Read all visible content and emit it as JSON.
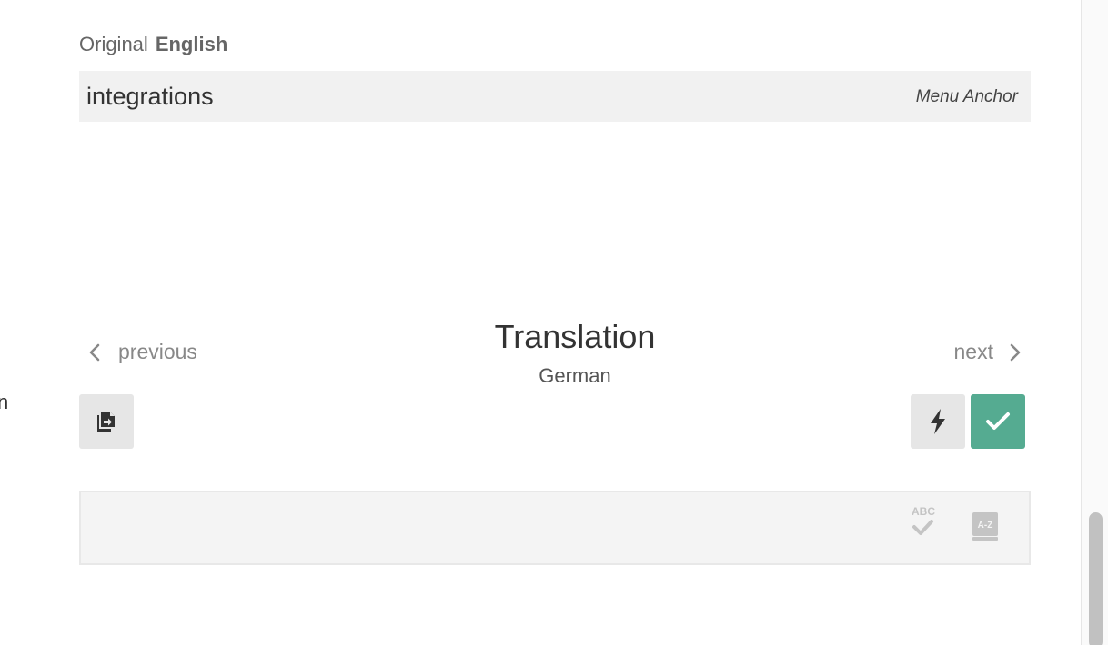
{
  "original": {
    "label": "Original",
    "language": "English",
    "text": "integrations",
    "context": "Menu Anchor"
  },
  "translation": {
    "title": "Translation",
    "language": "German",
    "text": ""
  },
  "navigation": {
    "previous_label": "previous",
    "next_label": "next"
  },
  "left_edge_fragment": "n",
  "icons": {
    "copy_original": "copy-original-icon",
    "machine_translate": "lightning-icon",
    "approve": "checkmark-icon",
    "spellcheck": "spellcheck-icon",
    "dictionary": "dictionary-icon",
    "previous": "chevron-left-icon",
    "next": "chevron-right-icon"
  },
  "spellcheck_label": "ABC",
  "dictionary_label": "A-Z",
  "colors": {
    "approve_button": "#55ab91",
    "secondary_button": "#e6e6e6",
    "original_box": "#f1f1f1",
    "translation_box": "#f4f4f4"
  }
}
